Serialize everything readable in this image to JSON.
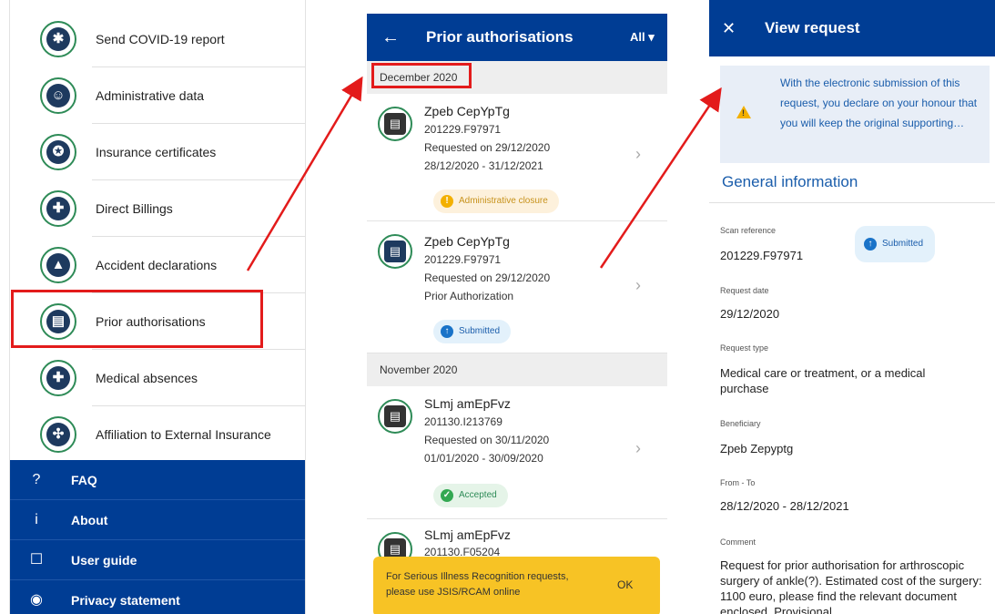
{
  "menu": {
    "items": [
      {
        "label": "Send COVID-19 report",
        "icon": "gear-icon",
        "glyph": "✱"
      },
      {
        "label": "Administrative data",
        "icon": "users-icon",
        "glyph": "☺"
      },
      {
        "label": "Insurance certificates",
        "icon": "certificate-icon",
        "glyph": "✪"
      },
      {
        "label": "Direct Billings",
        "icon": "ambulance-icon",
        "glyph": "✚"
      },
      {
        "label": "Accident declarations",
        "icon": "warning-icon",
        "glyph": "▲"
      },
      {
        "label": "Prior authorisations",
        "icon": "authorisation-icon",
        "glyph": "▤"
      },
      {
        "label": "Medical absences",
        "icon": "medical-kit-icon",
        "glyph": "✚"
      },
      {
        "label": "Affiliation to External Insurance",
        "icon": "puzzle-icon",
        "glyph": "✣"
      }
    ],
    "footer": [
      {
        "label": "FAQ",
        "icon": "question-icon",
        "glyph": "?"
      },
      {
        "label": "About",
        "icon": "info-icon",
        "glyph": "i"
      },
      {
        "label": "User guide",
        "icon": "book-icon",
        "glyph": "☐"
      },
      {
        "label": "Privacy statement",
        "icon": "shield-icon",
        "glyph": "◉"
      }
    ]
  },
  "list": {
    "back_glyph": "←",
    "title": "Prior authorisations",
    "filter": "All ▾",
    "groups": [
      {
        "month": "December 2020"
      },
      {
        "month": "November 2020"
      }
    ],
    "requests": [
      {
        "name": "Zpeb CepYpTg",
        "ref": "201229.F97971",
        "requested": "Requested on 29/12/2020",
        "extra": "28/12/2020 - 31/12/2021",
        "status": "Administrative closure",
        "status_glyph": "!"
      },
      {
        "name": "Zpeb CepYpTg",
        "ref": "201229.F97971",
        "requested": "Requested on 29/12/2020",
        "extra": "Prior Authorization",
        "status": "Submitted",
        "status_glyph": "↑"
      },
      {
        "name": "SLmj amEpFvz",
        "ref": "201130.I213769",
        "requested": "Requested on 30/11/2020",
        "extra": "01/01/2020 - 30/09/2020",
        "status": "Accepted",
        "status_glyph": "✓"
      },
      {
        "name": "SLmj amEpFvz",
        "ref": "201130.F05204"
      }
    ],
    "chevron": "›",
    "toast": {
      "text": "For Serious Illness Recognition requests, please use JSIS/RCAM online",
      "ok": "OK"
    }
  },
  "detail": {
    "close_glyph": "✕",
    "title": "View request",
    "warning": "With the electronic submission of this request, you declare on your honour that you will keep the original supporting…",
    "warning_glyph": "!",
    "section": "General information",
    "status": "Submitted",
    "status_glyph": "↑",
    "fields": [
      {
        "label": "Scan reference",
        "value": "201229.F97971"
      },
      {
        "label": "Request date",
        "value": "29/12/2020"
      },
      {
        "label": "Request type",
        "value": "Medical care or treatment, or a medical purchase"
      },
      {
        "label": "Beneficiary",
        "value": "Zpeb Zepyptg"
      },
      {
        "label": "From - To",
        "value": "28/12/2020 - 28/12/2021"
      },
      {
        "label": "Comment",
        "value": "Request for prior authorisation for arthroscopic surgery of ankle(?). Estimated cost of the surgery: 1100 euro, please find the relevant document enclosed. Provisional"
      }
    ]
  },
  "colors": {
    "brand": "#003d94",
    "accent_green": "#2e8b57",
    "highlight": "#e31b1b",
    "toast": "#f7c325"
  }
}
